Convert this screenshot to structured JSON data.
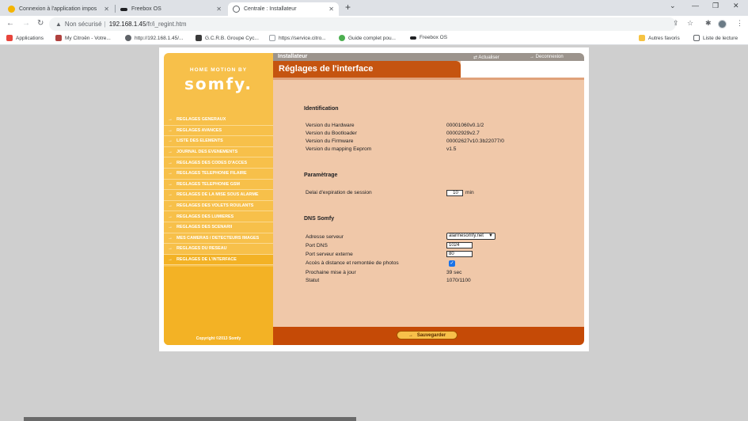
{
  "browser": {
    "tabs": [
      {
        "title": "Connexion à l'application impos",
        "favicon_color": "#f4b400"
      },
      {
        "title": "Freebox OS",
        "favicon_color": "#202124"
      },
      {
        "title": "Centrale : Installateur",
        "favicon_color": "#5f6368"
      }
    ],
    "address": {
      "security": "Non sécurisé",
      "host": "192.168.1.45",
      "path": "/fr/i_regint.htm"
    },
    "bookmarks": [
      {
        "label": "Applications",
        "icon_color": "#e8453c"
      },
      {
        "label": "My Citroën - Votre...",
        "icon_color": "#b0413e"
      },
      {
        "label": "http://192.168.1.45/...",
        "icon_color": "#5f6368"
      },
      {
        "label": "G.C.R.B. Groupe Cyc...",
        "icon_color": "#3a3a3a"
      },
      {
        "label": "https://service.citro...",
        "icon_color": "#dadce0"
      },
      {
        "label": "Guide complet pou...",
        "icon_color": "#4caf50"
      },
      {
        "label": "Freebox OS",
        "icon_color": "#202124"
      },
      {
        "label": "Autres favoris",
        "icon_color": "#f6c342"
      },
      {
        "label": "Liste de lecture",
        "icon_color": "#5f6368"
      }
    ]
  },
  "sidebar": {
    "brand_top": "HOME MOTION BY",
    "brand": "somfy.",
    "items": [
      "REGLAGES GENERAUX",
      "REGLAGES AVANCES",
      "LISTE DES ELEMENTS",
      "JOURNAL DES EVENEMENTS",
      "REGLAGES DES CODES D'ACCES",
      "REGLAGES TELEPHONIE FILAIRE",
      "REGLAGES TELEPHONIE GSM",
      "REGLAGES DE LA MISE SOUS ALARME",
      "REGLAGES DES VOLETS ROULANTS",
      "REGLAGES DES LUMIERES",
      "REGLAGES DES SCENARII",
      "MES CAMERAS / DETECTEURS IMAGES",
      "REGLAGES DU RESEAU",
      "REGLAGES DE L'INTERFACE"
    ],
    "copyright": "Copyright ©2013 Somfy"
  },
  "header": {
    "section": "Installateur",
    "refresh": "Actualiser",
    "logout": "Deconnexion",
    "title": "Réglages de l'interface"
  },
  "identification": {
    "heading": "Identification",
    "rows": [
      {
        "label": "Version du Hardware",
        "value": "00001060v0.1/2"
      },
      {
        "label": "Version du Bootloader",
        "value": "00002929v2.7"
      },
      {
        "label": "Version du Firmware",
        "value": "00002627v10.3b22077/0"
      },
      {
        "label": "Version du mapping Eeprom",
        "value": "v1.5"
      }
    ]
  },
  "parametrage": {
    "heading": "Paramètrage",
    "session_label": "Delai d'expiration de session",
    "session_value": "10",
    "session_unit": "min"
  },
  "dns": {
    "heading": "DNS Somfy",
    "server_label": "Adresse serveur",
    "server_value": "alarmesomfy.net",
    "port_label": "Port DNS",
    "port_value": "1024",
    "ext_port_label": "Port serveur externe",
    "ext_port_value": "80",
    "remote_label": "Accès à distance et remontée de photos",
    "remote_checked": true,
    "next_update_label": "Prochaine mise à jour",
    "next_update_value": "39 sec",
    "status_label": "Statut",
    "status_value": "1070/1100"
  },
  "footer": {
    "save_label": "Sauvegarder"
  },
  "colors": {
    "sidebar": "#f7c04a",
    "title": "#c55410",
    "panel": "#f0c8a9"
  }
}
